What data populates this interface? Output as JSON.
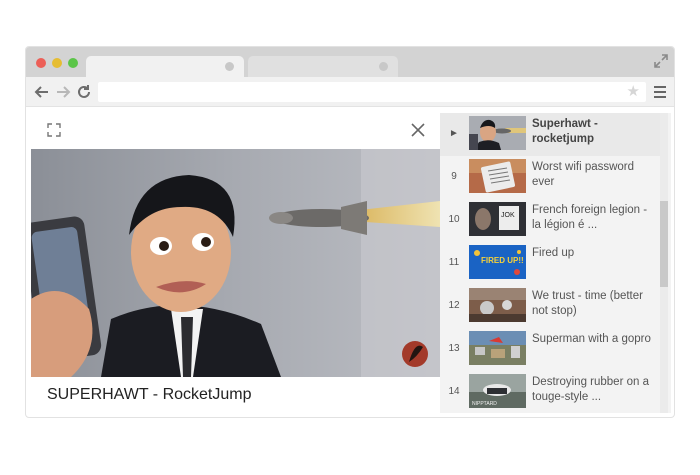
{
  "player": {
    "caption": "SUPERHAWT - RocketJump"
  },
  "playlist": {
    "items": [
      {
        "index": "►",
        "title": "Superhawt - rocketjump",
        "current": true
      },
      {
        "index": "9",
        "title": "Worst wifi password ever"
      },
      {
        "index": "10",
        "title": "French foreign legion - la légion é ..."
      },
      {
        "index": "11",
        "title": "Fired up"
      },
      {
        "index": "12",
        "title": "We trust - time (better not stop)"
      },
      {
        "index": "13",
        "title": "Superman with a gopro"
      },
      {
        "index": "14",
        "title": "Destroying rubber on a touge-style  ..."
      }
    ],
    "thumb_texts": {
      "item10": "JOK",
      "item11": "FIRED UP!!",
      "item14": "NIPPTARD"
    }
  },
  "colors": {
    "close_dot": "#ec5f57",
    "minimize_dot": "#e6bd32",
    "zoom_dot": "#5bc548",
    "logo_badge": "#a33a2a"
  },
  "icons": {
    "back": "back-arrow-icon",
    "forward": "forward-arrow-icon",
    "reload": "reload-icon",
    "star": "star-icon",
    "menu": "hamburger-menu-icon",
    "fullscreen": "fullscreen-icon",
    "close": "close-icon"
  }
}
